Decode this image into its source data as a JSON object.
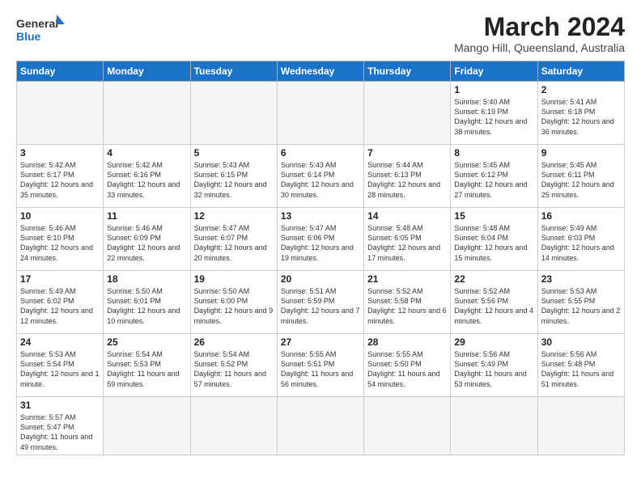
{
  "header": {
    "logo_general": "General",
    "logo_blue": "Blue",
    "month_title": "March 2024",
    "location": "Mango Hill, Queensland, Australia"
  },
  "days_of_week": [
    "Sunday",
    "Monday",
    "Tuesday",
    "Wednesday",
    "Thursday",
    "Friday",
    "Saturday"
  ],
  "weeks": [
    [
      {
        "day": "",
        "info": ""
      },
      {
        "day": "",
        "info": ""
      },
      {
        "day": "",
        "info": ""
      },
      {
        "day": "",
        "info": ""
      },
      {
        "day": "",
        "info": ""
      },
      {
        "day": "1",
        "info": "Sunrise: 5:40 AM\nSunset: 6:19 PM\nDaylight: 12 hours and 38 minutes."
      },
      {
        "day": "2",
        "info": "Sunrise: 5:41 AM\nSunset: 6:18 PM\nDaylight: 12 hours and 36 minutes."
      }
    ],
    [
      {
        "day": "3",
        "info": "Sunrise: 5:42 AM\nSunset: 6:17 PM\nDaylight: 12 hours and 35 minutes."
      },
      {
        "day": "4",
        "info": "Sunrise: 5:42 AM\nSunset: 6:16 PM\nDaylight: 12 hours and 33 minutes."
      },
      {
        "day": "5",
        "info": "Sunrise: 5:43 AM\nSunset: 6:15 PM\nDaylight: 12 hours and 32 minutes."
      },
      {
        "day": "6",
        "info": "Sunrise: 5:43 AM\nSunset: 6:14 PM\nDaylight: 12 hours and 30 minutes."
      },
      {
        "day": "7",
        "info": "Sunrise: 5:44 AM\nSunset: 6:13 PM\nDaylight: 12 hours and 28 minutes."
      },
      {
        "day": "8",
        "info": "Sunrise: 5:45 AM\nSunset: 6:12 PM\nDaylight: 12 hours and 27 minutes."
      },
      {
        "day": "9",
        "info": "Sunrise: 5:45 AM\nSunset: 6:11 PM\nDaylight: 12 hours and 25 minutes."
      }
    ],
    [
      {
        "day": "10",
        "info": "Sunrise: 5:46 AM\nSunset: 6:10 PM\nDaylight: 12 hours and 24 minutes."
      },
      {
        "day": "11",
        "info": "Sunrise: 5:46 AM\nSunset: 6:09 PM\nDaylight: 12 hours and 22 minutes."
      },
      {
        "day": "12",
        "info": "Sunrise: 5:47 AM\nSunset: 6:07 PM\nDaylight: 12 hours and 20 minutes."
      },
      {
        "day": "13",
        "info": "Sunrise: 5:47 AM\nSunset: 6:06 PM\nDaylight: 12 hours and 19 minutes."
      },
      {
        "day": "14",
        "info": "Sunrise: 5:48 AM\nSunset: 6:05 PM\nDaylight: 12 hours and 17 minutes."
      },
      {
        "day": "15",
        "info": "Sunrise: 5:48 AM\nSunset: 6:04 PM\nDaylight: 12 hours and 15 minutes."
      },
      {
        "day": "16",
        "info": "Sunrise: 5:49 AM\nSunset: 6:03 PM\nDaylight: 12 hours and 14 minutes."
      }
    ],
    [
      {
        "day": "17",
        "info": "Sunrise: 5:49 AM\nSunset: 6:02 PM\nDaylight: 12 hours and 12 minutes."
      },
      {
        "day": "18",
        "info": "Sunrise: 5:50 AM\nSunset: 6:01 PM\nDaylight: 12 hours and 10 minutes."
      },
      {
        "day": "19",
        "info": "Sunrise: 5:50 AM\nSunset: 6:00 PM\nDaylight: 12 hours and 9 minutes."
      },
      {
        "day": "20",
        "info": "Sunrise: 5:51 AM\nSunset: 5:59 PM\nDaylight: 12 hours and 7 minutes."
      },
      {
        "day": "21",
        "info": "Sunrise: 5:52 AM\nSunset: 5:58 PM\nDaylight: 12 hours and 6 minutes."
      },
      {
        "day": "22",
        "info": "Sunrise: 5:52 AM\nSunset: 5:56 PM\nDaylight: 12 hours and 4 minutes."
      },
      {
        "day": "23",
        "info": "Sunrise: 5:53 AM\nSunset: 5:55 PM\nDaylight: 12 hours and 2 minutes."
      }
    ],
    [
      {
        "day": "24",
        "info": "Sunrise: 5:53 AM\nSunset: 5:54 PM\nDaylight: 12 hours and 1 minute."
      },
      {
        "day": "25",
        "info": "Sunrise: 5:54 AM\nSunset: 5:53 PM\nDaylight: 11 hours and 59 minutes."
      },
      {
        "day": "26",
        "info": "Sunrise: 5:54 AM\nSunset: 5:52 PM\nDaylight: 11 hours and 57 minutes."
      },
      {
        "day": "27",
        "info": "Sunrise: 5:55 AM\nSunset: 5:51 PM\nDaylight: 11 hours and 56 minutes."
      },
      {
        "day": "28",
        "info": "Sunrise: 5:55 AM\nSunset: 5:50 PM\nDaylight: 11 hours and 54 minutes."
      },
      {
        "day": "29",
        "info": "Sunrise: 5:56 AM\nSunset: 5:49 PM\nDaylight: 11 hours and 53 minutes."
      },
      {
        "day": "30",
        "info": "Sunrise: 5:56 AM\nSunset: 5:48 PM\nDaylight: 11 hours and 51 minutes."
      }
    ],
    [
      {
        "day": "31",
        "info": "Sunrise: 5:57 AM\nSunset: 5:47 PM\nDaylight: 11 hours and 49 minutes."
      },
      {
        "day": "",
        "info": ""
      },
      {
        "day": "",
        "info": ""
      },
      {
        "day": "",
        "info": ""
      },
      {
        "day": "",
        "info": ""
      },
      {
        "day": "",
        "info": ""
      },
      {
        "day": "",
        "info": ""
      }
    ]
  ]
}
